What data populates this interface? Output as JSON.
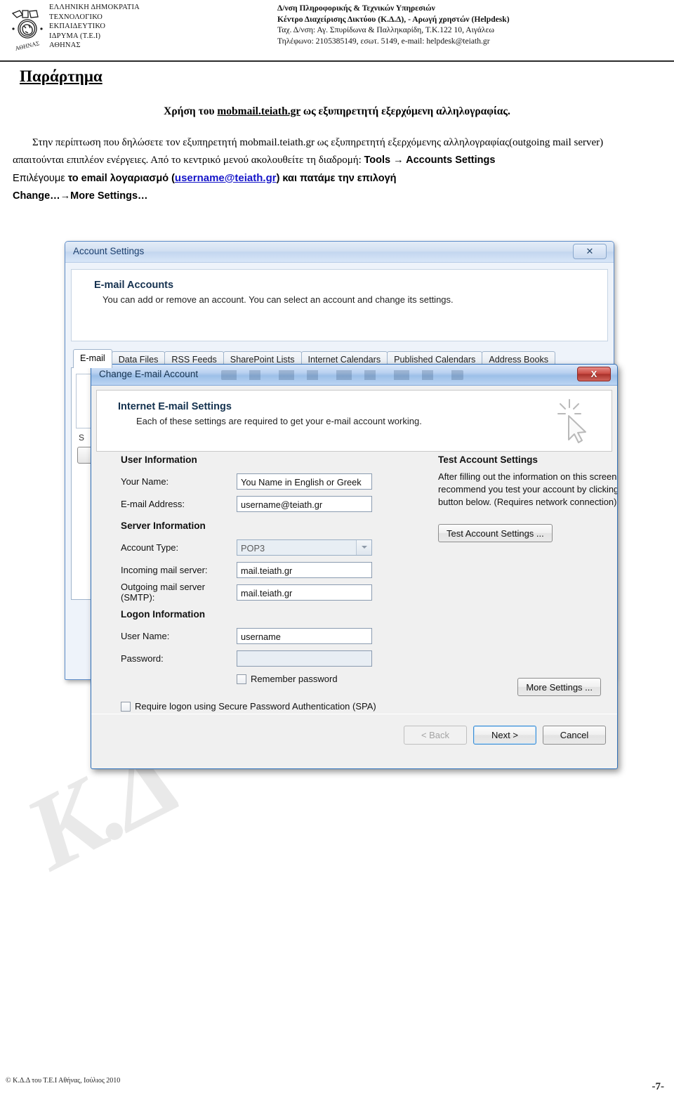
{
  "header": {
    "org_lines": [
      "ΕΛΛΗΝΙΚΗ ΔΗΜΟΚΡΑΤΙΑ",
      "ΤΕΧΝΟΛΟΓΙΚΟ",
      "ΕΚΠΑΙΔΕΥΤΙΚΟ",
      "ΙΔΡΥΜΑ (Τ.Ε.Ι)",
      "ΑΘΗΝΑΣ"
    ],
    "logo_text": "ΤΕΙ ΑΘΗΝΑΣ",
    "dept_line1": "Δ/νση Πληροφορικής & Τεχνικών Υπηρεσιών",
    "dept_line2": "Κέντρο Διαχείρισης Δικτύου (Κ.Δ.Δ), - Αρωγή χρηστών (Helpdesk)",
    "dept_line3": "Ταχ. Δ/νση: Αγ. Σπυρίδωνα & Παλληκαρίδη, Τ.Κ.122 10, Αιγάλεω",
    "dept_line4": "Τηλέφωνο: 2105385149, εσωτ. 5149,  e-mail: helpdesk@teiath.gr"
  },
  "document": {
    "title": "Παράρτημα",
    "subtitle_a": "Χρήση του ",
    "subtitle_link": "mobmail.teiath.gr",
    "subtitle_b": " ως εξυπηρετητή εξερχόμενη αλληλογραφίας.",
    "para1_a": "Στην περίπτωση που δηλώσετε τον εξυπηρετητή mobmail.teiath.gr  ως εξυπηρετητή εξερχόμενης αλληλογραφίας(outgoing mail server)  απαιτούνται επιπλέον ενέργειες.  Από το κεντρικό μενού  ακολουθείτε τη διαδρομή: ",
    "para1_path": "Tools → Accounts Settings",
    "para2_a": "Επιλέγουμε ",
    "para2_b": "το email λογαριασμό (",
    "para2_link": "username@teiath.gr",
    "para2_c": ") και πατάμε την επιλογή",
    "para3": "Change…→More Settings…",
    "watermark": "Κ.Δ"
  },
  "account_settings_window": {
    "title": "Account Settings",
    "close_label": "✕",
    "panel_heading": "E-mail Accounts",
    "panel_text": "You can add or remove an account. You can select an account and change its settings.",
    "tabs": [
      {
        "label": "E-mail",
        "active": true
      },
      {
        "label": "Data Files",
        "active": false
      },
      {
        "label": "RSS Feeds",
        "active": false
      },
      {
        "label": "SharePoint Lists",
        "active": false
      },
      {
        "label": "Internet Calendars",
        "active": false
      },
      {
        "label": "Published Calendars",
        "active": false
      },
      {
        "label": "Address Books",
        "active": false
      }
    ],
    "obscured_label": "S"
  },
  "change_account_window": {
    "title": "Change E-mail Account",
    "close_label": "X",
    "panel_heading": "Internet E-mail Settings",
    "panel_text": "Each of these settings are required to get your e-mail account working.",
    "user_information": {
      "group_label": "User Information",
      "your_name_label": "Your Name:",
      "your_name_value": "You Name in English or Greek",
      "email_label": "E-mail Address:",
      "email_value": "username@teiath.gr"
    },
    "server_information": {
      "group_label": "Server Information",
      "account_type_label": "Account Type:",
      "account_type_value": "POP3",
      "incoming_label": "Incoming mail server:",
      "incoming_value": "mail.teiath.gr",
      "outgoing_label": "Outgoing mail server (SMTP):",
      "outgoing_value": "mail.teiath.gr"
    },
    "logon_information": {
      "group_label": "Logon Information",
      "username_label": "User Name:",
      "username_value": "username",
      "password_label": "Password:",
      "password_value": "",
      "remember_password_label": "Remember password",
      "remember_password_checked": false,
      "spa_label": "Require logon using Secure Password Authentication (SPA)",
      "spa_checked": false
    },
    "test_account": {
      "group_label": "Test Account Settings",
      "description": "After filling out the information on this screen, we recommend you test your account by clicking the button below. (Requires network connection)",
      "button_label": "Test Account Settings ..."
    },
    "more_settings_label": "More Settings ...",
    "footer_buttons": {
      "back_label": "< Back",
      "next_label": "Next >",
      "cancel_label": "Cancel"
    }
  },
  "footer": {
    "copyright": "© Κ.Δ.Δ του Τ.Ε.Ι Αθήνας, Ιούλιος 2010",
    "page_number": "-7-"
  }
}
